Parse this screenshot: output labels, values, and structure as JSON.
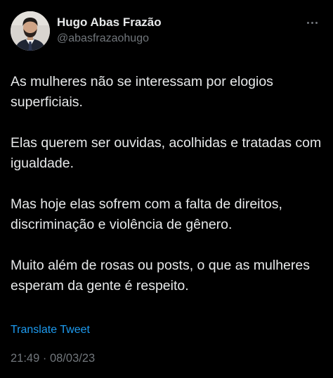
{
  "author": {
    "display_name": "Hugo Abas Frazão",
    "handle": "@abasfrazaohugo"
  },
  "header": {
    "more_icon": "more-horizontal-icon"
  },
  "tweet": {
    "paragraphs": [
      "As mulheres não se interessam por elogios superficiais.",
      "Elas querem ser ouvidas, acolhidas e tratadas com igualdade.",
      "Mas hoje elas sofrem com a falta de direitos, discriminação e violência de gênero.",
      "Muito além de rosas ou posts, o que as mulheres esperam da gente é respeito."
    ],
    "translate_label": "Translate Tweet",
    "timestamp": "21:49 · 08/03/23"
  },
  "colors": {
    "background": "#000000",
    "text": "#e7e9ea",
    "secondary": "#71767b",
    "link": "#1d9bf0"
  }
}
